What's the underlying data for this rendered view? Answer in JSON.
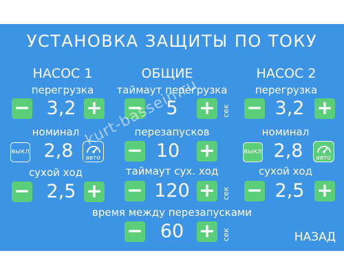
{
  "title": "УСТАНОВКА ЗАЩИТЫ ПО ТОКУ",
  "columns": {
    "pump1": "НАСОС 1",
    "common": "ОБЩИЕ",
    "pump2": "НАСОС 2"
  },
  "pump1": {
    "overload_label": "перегрузка",
    "overload_value": "3,2",
    "nominal_label": "номинал",
    "nominal_value": "2,8",
    "off_label": "выкл",
    "auto_label": "авто",
    "dry_run_label": "сухой ход",
    "dry_run_value": "2,5"
  },
  "pump2": {
    "overload_label": "перегрузка",
    "overload_value": "3,2",
    "nominal_label": "номинал",
    "nominal_value": "2,8",
    "off_label": "выкл",
    "auto_label": "авто",
    "dry_run_label": "сухой ход",
    "dry_run_value": "2,5"
  },
  "common": {
    "overload_timeout_label": "таймаут перегрузка",
    "overload_timeout_value": "5",
    "restarts_label": "перезапусков",
    "restarts_value": "10",
    "dry_timeout_label": "таймаут сух. ход",
    "dry_timeout_value": "120",
    "between_restarts_label": "время между перезапусками",
    "between_restarts_value": "60",
    "unit_sec": "сек"
  },
  "buttons": {
    "minus": "−",
    "plus": "+",
    "back": "НАЗАД"
  },
  "watermark": "kurt-bassein.ru",
  "colors": {
    "panel": "#3d93e4",
    "button": "#5ccd78",
    "text": "#ffffff"
  }
}
